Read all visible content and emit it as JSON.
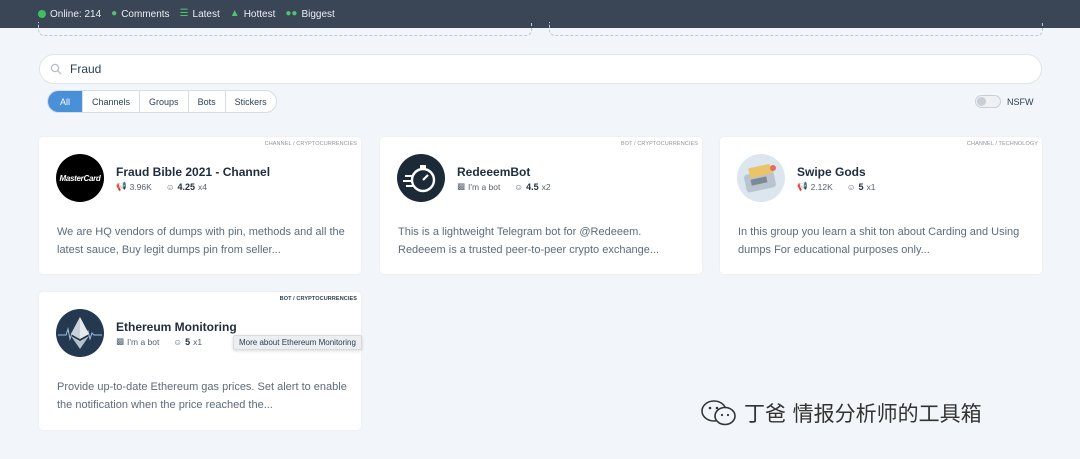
{
  "topbar": {
    "online": "Online: 214",
    "comments": "Comments",
    "latest": "Latest",
    "hottest": "Hottest",
    "biggest": "Biggest"
  },
  "search": {
    "value": "Fraud"
  },
  "filters": [
    "All",
    "Channels",
    "Groups",
    "Bots",
    "Stickers"
  ],
  "nsfw_label": "NSFW",
  "cards": [
    {
      "tag": "CHANNEL / CRYPTOCURRENCIES",
      "title": "Fraud Bible 2021 - Channel",
      "count": "3.96K",
      "rating": "4.25",
      "votes": "x4",
      "desc": "We are HQ vendors of dumps with pin, methods and all the latest sauce, Buy legit dumps pin from seller...",
      "avatar_text": "MasterCard",
      "avatar_icon": "mastercard-logo"
    },
    {
      "tag": "BOT / CRYPTOCURRENCIES",
      "title": "RedeeemBot",
      "bot_label": "I'm a bot",
      "rating": "4.5",
      "votes": "x2",
      "desc": "This is a lightweight Telegram bot for @Redeeem. Redeeem is a trusted peer-to-peer crypto exchange...",
      "avatar_icon": "stopwatch-icon"
    },
    {
      "tag": "CHANNEL / TECHNOLOGY",
      "title": "Swipe Gods",
      "count": "2.12K",
      "rating": "5",
      "votes": "x1",
      "desc": "In this group you learn a shit ton about Carding and Using dumps For educational purposes only...",
      "avatar_icon": "card-swipe-machine"
    },
    {
      "tag": "BOT / CRYPTOCURRENCIES",
      "title": "Ethereum Monitoring",
      "bot_label": "I'm a bot",
      "rating": "5",
      "votes": "x1",
      "desc": "Provide up-to-date Ethereum gas prices. Set alert to enable the notification when the price reached the...",
      "avatar_icon": "ethereum-logo"
    }
  ],
  "tooltip": "More about Ethereum Monitoring",
  "watermark": "丁爸 情报分析师的工具箱",
  "colors": {
    "topbar": "#3a4556",
    "accent": "#4a90d9",
    "online_dot": "#3fbf5f",
    "background": "#f2f5f9"
  }
}
